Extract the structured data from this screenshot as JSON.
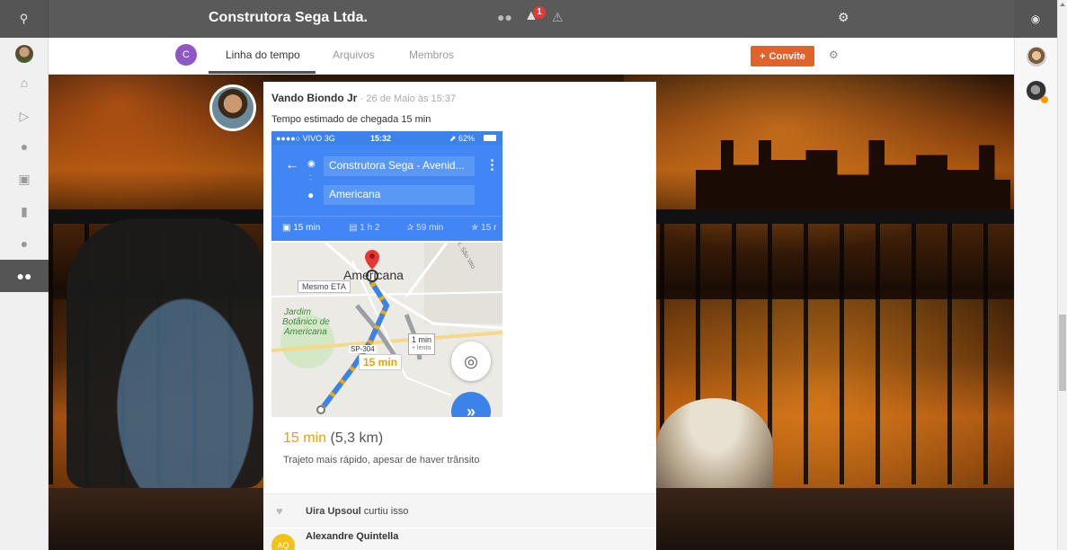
{
  "topbar": {
    "title": "Construtora Sega Ltda.",
    "notification_count": "1"
  },
  "subnav": {
    "group_initial": "C",
    "tabs": [
      {
        "label": "Linha do tempo",
        "active": true
      },
      {
        "label": "Arquivos",
        "active": false
      },
      {
        "label": "Membros",
        "active": false
      }
    ],
    "invite_label": "Convite"
  },
  "post": {
    "author": "Vando Biondo Jr",
    "date": "· 26 de Maio às 15:37",
    "text": "Tempo estimado de chegada 15 min",
    "eta_minutes": "15",
    "eta_unit": "min",
    "eta_distance": "(5,3 km)",
    "eta_description": "Trajeto mais rápido, apesar de haver trânsito",
    "likes": {
      "name": "Uira Upsoul",
      "suffix": "curtiu isso"
    },
    "comment": {
      "initials": "AQ",
      "name": "Alexandre Quintella"
    }
  },
  "phone": {
    "status_carrier": "●●●●○ VIVO  3G",
    "status_time": "15:32",
    "status_battery": "⬈ 62%",
    "origin": "Construtora Sega - Avenid...",
    "destination": "Americana",
    "modes": [
      {
        "label": "15 min",
        "icon": "car-icon"
      },
      {
        "label": "1 h 2",
        "icon": "transit-icon"
      },
      {
        "label": "59 min",
        "icon": "walk-icon"
      },
      {
        "label": "15 r",
        "icon": "bike-icon"
      }
    ],
    "map": {
      "city_label": "Americana",
      "same_eta_chip": "Mesmo ETA",
      "park_label_1": "Jardim",
      "park_label_2": "Botânico de",
      "park_label_3": "Americana",
      "road_label": "SP-304",
      "route_time": "15 min",
      "slow_time": "1 min",
      "slow_note": "+ lento",
      "street_label": "R. São Vito"
    }
  },
  "colors": {
    "accent_orange": "#e2632a",
    "maps_blue": "#4285f4",
    "eta_yellow": "#e6a400",
    "group_purple": "#8e56c6",
    "topbar_gray": "#5a5a5a"
  },
  "icons": {
    "left_sidebar": [
      "home-icon",
      "megaphone-icon",
      "chat-icon",
      "document-icon",
      "book-icon",
      "user-icon",
      "group-icon"
    ],
    "topbar": [
      "search-icon",
      "chat-icon",
      "bell-icon",
      "warning-icon",
      "gear-icon",
      "chat-bubble-icon"
    ]
  }
}
